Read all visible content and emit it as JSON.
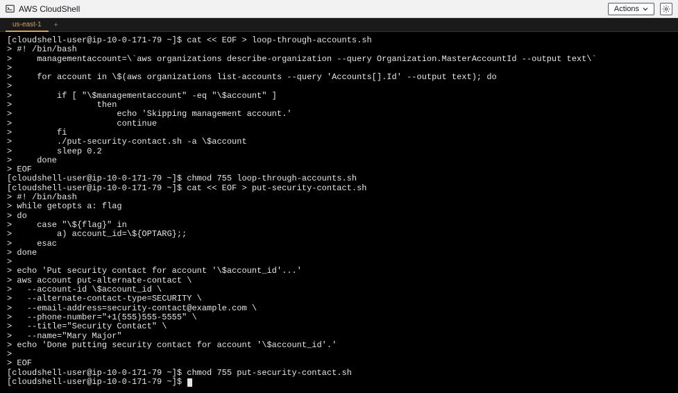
{
  "header": {
    "title": "AWS CloudShell",
    "actions_label": "Actions"
  },
  "tabs": {
    "active": "us-east-1"
  },
  "terminal": {
    "prompt": "[cloudshell-user@ip-10-0-171-79 ~]$ ",
    "lines": [
      "[cloudshell-user@ip-10-0-171-79 ~]$ cat << EOF > loop-through-accounts.sh",
      "> #! /bin/bash",
      ">     managementaccount=\\`aws organizations describe-organization --query Organization.MasterAccountId --output text\\`",
      ">",
      ">     for account in \\$(aws organizations list-accounts --query 'Accounts[].Id' --output text); do",
      ">",
      ">         if [ \"\\$managementaccount\" -eq \"\\$account\" ]",
      ">                 then",
      ">                     echo 'Skipping management account.'",
      ">                     continue",
      ">         fi",
      ">         ./put-security-contact.sh -a \\$account",
      ">         sleep 0.2",
      ">     done",
      "> EOF",
      "[cloudshell-user@ip-10-0-171-79 ~]$ chmod 755 loop-through-accounts.sh",
      "[cloudshell-user@ip-10-0-171-79 ~]$ cat << EOF > put-security-contact.sh",
      "> #! /bin/bash",
      "> while getopts a: flag",
      "> do",
      ">     case \"\\${flag}\" in",
      ">         a) account_id=\\${OPTARG};;",
      ">     esac",
      "> done",
      ">",
      "> echo 'Put security contact for account '\\$account_id'...'",
      "> aws account put-alternate-contact \\",
      ">   --account-id \\$account_id \\",
      ">   --alternate-contact-type=SECURITY \\",
      ">   --email-address=security-contact@example.com \\",
      ">   --phone-number=\"+1(555)555-5555\" \\",
      ">   --title=\"Security Contact\" \\",
      ">   --name=\"Mary Major\"",
      "> echo 'Done putting security contact for account '\\$account_id'.'",
      ">",
      "> EOF",
      "[cloudshell-user@ip-10-0-171-79 ~]$ chmod 755 put-security-contact.sh"
    ],
    "current_prompt": "[cloudshell-user@ip-10-0-171-79 ~]$ "
  }
}
